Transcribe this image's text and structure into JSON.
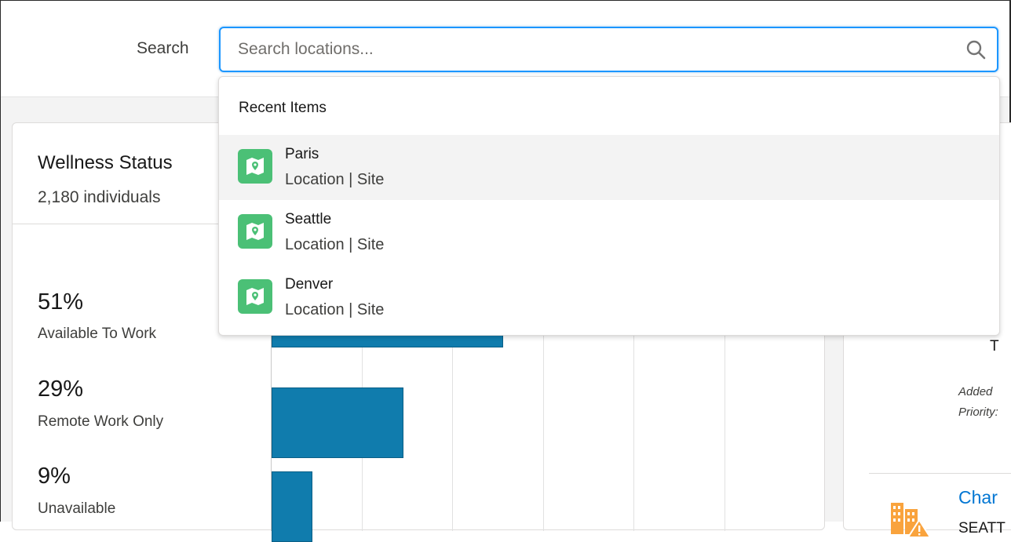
{
  "search": {
    "label": "Search",
    "placeholder": "Search locations...",
    "value": ""
  },
  "dropdown": {
    "header": "Recent Items",
    "items": [
      {
        "name": "Paris",
        "subtitle": "Location | Site",
        "icon": "location-map-icon",
        "highlighted": true
      },
      {
        "name": "Seattle",
        "subtitle": "Location | Site",
        "icon": "location-map-icon",
        "highlighted": false
      },
      {
        "name": "Denver",
        "subtitle": "Location | Site",
        "icon": "location-map-icon",
        "highlighted": false
      }
    ]
  },
  "wellness": {
    "title": "Wellness Status",
    "count": "2,180 individuals",
    "stats": [
      {
        "percent": "51%",
        "label": "Available To Work"
      },
      {
        "percent": "29%",
        "label": "Remote Work Only"
      },
      {
        "percent": "9%",
        "label": "Unavailable"
      }
    ]
  },
  "chart_data": {
    "type": "bar",
    "orientation": "horizontal",
    "categories": [
      "Available To Work",
      "Remote Work Only",
      "Unavailable"
    ],
    "values": [
      51,
      29,
      9
    ],
    "xlim": [
      0,
      100
    ],
    "grid": true
  },
  "right_card": {
    "partial_text_1": "t",
    "partial_link_1": "c",
    "partial_text_2": "T",
    "added_label": "Added",
    "priority_label": "Priority:",
    "link_partial": "Char",
    "location_partial": "SEATT",
    "icon": "building-warning-icon"
  },
  "colors": {
    "accent": "#1b96ff",
    "bar": "#107cad",
    "location_icon_bg": "#4bc076",
    "link": "#0176d3",
    "warning_icon": "#f9a33d"
  }
}
